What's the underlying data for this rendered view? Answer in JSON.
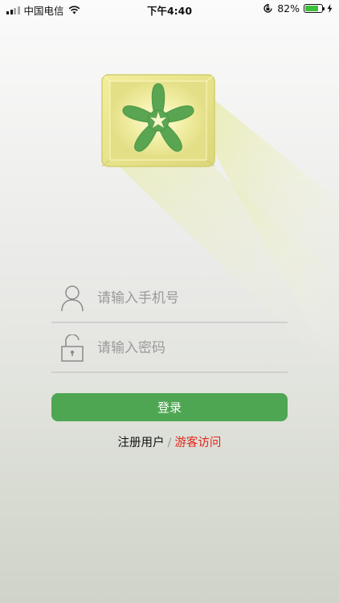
{
  "status_bar": {
    "carrier": "中国电信",
    "time": "下午4:40",
    "battery_percent": "82%",
    "battery_level": 0.82,
    "icons": [
      "signal-icon",
      "wifi-icon",
      "rotation-lock-icon",
      "battery-icon",
      "charging-bolt-icon"
    ]
  },
  "logo": {
    "icon": "asterisk-logo-icon",
    "colors": {
      "tile": "#e8e48a",
      "asterisk": "#5aa552",
      "beam": "#e7ec9c"
    }
  },
  "form": {
    "phone": {
      "placeholder": "请输入手机号",
      "value": "",
      "icon": "user-icon"
    },
    "password": {
      "placeholder": "请输入密码",
      "value": "",
      "icon": "lock-icon"
    },
    "login_label": "登录"
  },
  "links": {
    "register": "注册用户",
    "separator": "/",
    "guest": "游客访问"
  },
  "colors": {
    "accent": "#4ea653",
    "guest_link": "#e0261c"
  }
}
